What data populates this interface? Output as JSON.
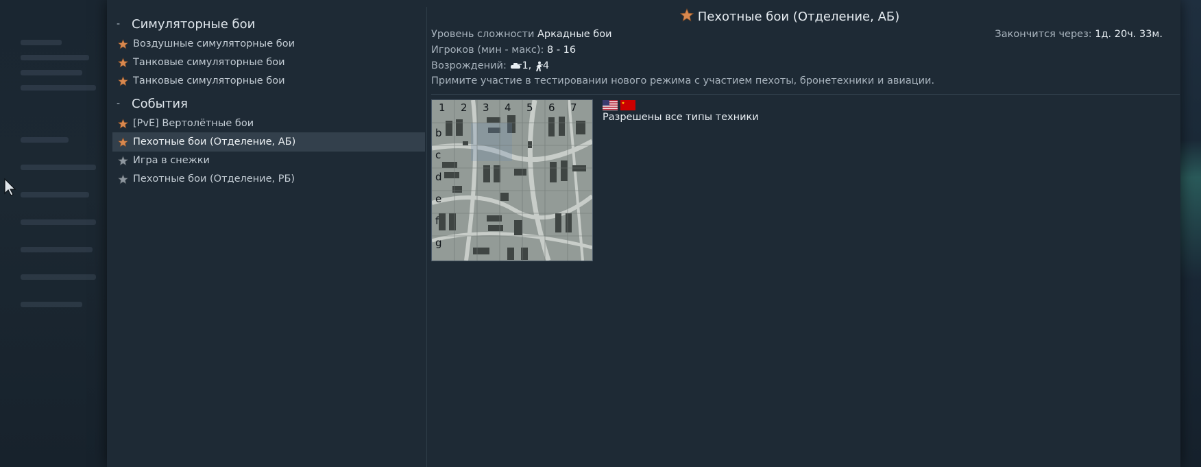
{
  "sidebar": {
    "groups": [
      {
        "dash": "-",
        "title": "Симуляторные бои",
        "items": [
          {
            "label": "Воздушные симуляторные бои",
            "icon": "bronze-star-icon"
          },
          {
            "label": "Танковые симуляторные бои",
            "icon": "bronze-star-icon"
          },
          {
            "label": "Танковые симуляторные бои",
            "icon": "bronze-star-icon"
          }
        ]
      },
      {
        "dash": "-",
        "title": "События",
        "items": [
          {
            "label": "[PvE] Вертолётные бои",
            "icon": "bronze-star-icon"
          },
          {
            "label": "Пехотные бои (Отделение, АБ)",
            "icon": "bronze-star-icon",
            "selected": true
          },
          {
            "label": "Игра в снежки",
            "icon": "grey-star-icon"
          },
          {
            "label": "Пехотные бои (Отделение, РБ)",
            "icon": "grey-star-icon"
          }
        ]
      }
    ]
  },
  "event": {
    "title": "Пехотные бои (Отделение, АБ)",
    "difficulty_label": "Уровень сложности ",
    "difficulty_value": "Аркадные бои",
    "players_label": "Игроков (мин - макс): ",
    "players_value": "8 - 16",
    "respawns_label": "Возрождений: ",
    "respawns_vehicle": "1",
    "respawns_infantry": "4",
    "description": "Примите участие в тестировании нового режима с участием пехоты, бронетехники и авиации.",
    "ends_label": "Закончится через: ",
    "ends_value": "1д. 20ч. 33м.",
    "vehicles_text": "Разрешены все типы техники",
    "flags": [
      "usa-flag",
      "ussr-flag"
    ]
  },
  "map": {
    "columns": [
      "1",
      "2",
      "3",
      "4",
      "5",
      "6",
      "7"
    ],
    "rows": [
      "b",
      "c",
      "d",
      "e",
      "f",
      "g"
    ]
  },
  "colors": {
    "panel": "#1e2a35",
    "selected_row": "#33404c",
    "bronze_star": "#d9884e",
    "grey_star": "#8d969e"
  }
}
